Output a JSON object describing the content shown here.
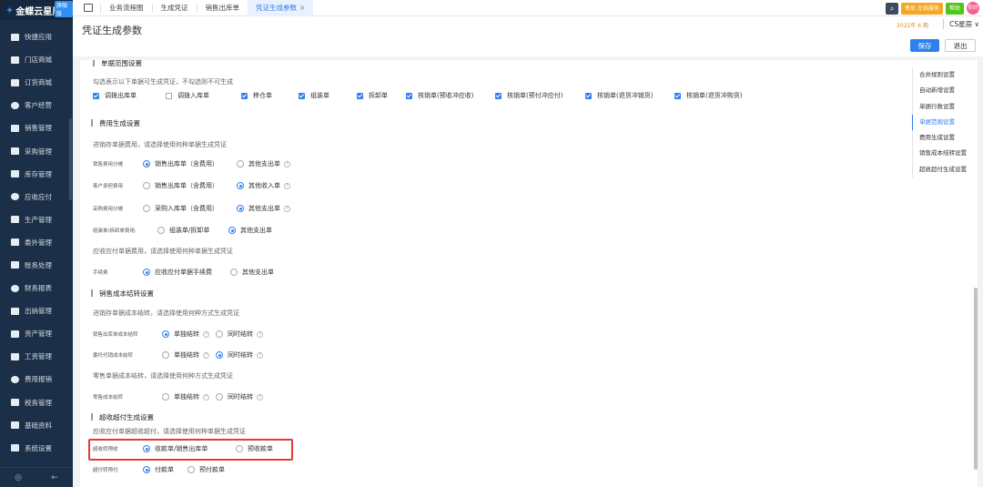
{
  "app": {
    "brand": "金蝶云星辰",
    "brand_tag": "旗舰版"
  },
  "sidebar": {
    "items": [
      {
        "label": "快捷应用"
      },
      {
        "label": "门店商城"
      },
      {
        "label": "订货商城"
      },
      {
        "label": "客户经营"
      },
      {
        "label": "销售管理"
      },
      {
        "label": "采购管理"
      },
      {
        "label": "库存管理"
      },
      {
        "label": "应收应付"
      },
      {
        "label": "生产管理"
      },
      {
        "label": "委外管理"
      },
      {
        "label": "账务处理"
      },
      {
        "label": "财务报表"
      },
      {
        "label": "出纳管理"
      },
      {
        "label": "资产管理"
      },
      {
        "label": "工资管理"
      },
      {
        "label": "费用报销"
      },
      {
        "label": "税务管理"
      },
      {
        "label": "基础资料"
      },
      {
        "label": "系统设置"
      }
    ],
    "footer_left": "◎",
    "footer_right": "←"
  },
  "topbar": {
    "tabs": [
      {
        "label": "业务流程图"
      },
      {
        "label": "生成凭证"
      },
      {
        "label": "销售出库单"
      },
      {
        "label": "凭证生成参数"
      }
    ],
    "active_tab_close": "×",
    "service_label": "售后 在线服务",
    "help_label": "帮助",
    "avatar_text": "你好"
  },
  "header": {
    "title": "凭证生成参数",
    "period": "2022年 6 期",
    "account": "CS星辰 ∨",
    "save_label": "保存",
    "exit_label": "退出"
  },
  "content": {
    "cut_heading": "单据范围设置",
    "scope_desc": "勾选表示以下单据可生成凭证，不勾选则不可生成",
    "scope_items": [
      {
        "label": "调拨出库单",
        "checked": true
      },
      {
        "label": "调拨入库单",
        "checked": false
      },
      {
        "label": "移仓单",
        "checked": true
      },
      {
        "label": "组装单",
        "checked": true
      },
      {
        "label": "拆卸单",
        "checked": true
      },
      {
        "label": "核销单(预收冲应收)",
        "checked": true
      },
      {
        "label": "核销单(预付冲应付)",
        "checked": true
      },
      {
        "label": "核销单(退货冲销货)",
        "checked": true
      },
      {
        "label": "核销单(退货冲购货)",
        "checked": true
      }
    ],
    "fee_section": "费用生成设置",
    "fee_desc": "进销存单据费用，请选择使用何种单据生成凭证",
    "fee_rows": [
      {
        "label": "销售费用分摊",
        "opt1": "销售出库单（含费用）",
        "opt2": "其他支出单",
        "selected": 1
      },
      {
        "label": "客户承担费用",
        "opt1": "销售出库单（含费用）",
        "opt2": "其他收入单",
        "selected": 2
      },
      {
        "label": "采购费用分摊",
        "opt1": "采购入库单（含费用）",
        "opt2": "其他支出单",
        "selected": 2
      },
      {
        "label": "组装单/拆卸单费用:",
        "opt1": "组装单/拆卸单",
        "opt2": "其他支出单",
        "selected": 2
      }
    ],
    "arap_desc": "应收应付单据费用，请选择使用何种单据生成凭证",
    "handling": {
      "label": "手续费",
      "opt1": "应收应付单据手续费",
      "opt2": "其他支出单",
      "selected": 1
    },
    "cost_section": "销售成本结转设置",
    "cost_desc": "进销存单据成本结转，请选择使用何种方式生成凭证",
    "cost_rows": [
      {
        "label": "销售出库单成本结转",
        "opt1": "单独结转",
        "opt2": "同时结转",
        "selected": 1
      },
      {
        "label": "委托代销成本结转",
        "opt1": "单独结转",
        "opt2": "同时结转",
        "selected": 2
      }
    ],
    "retail_desc": "零售单据成本结转，请选择使用何种方式生成凭证",
    "retail_row": {
      "label": "零售成本结转",
      "opt1": "单独结转",
      "opt2": "同时结转",
      "selected": 0
    },
    "over_section": "超收超付生成设置",
    "over_desc": "应收应付单据超收超付，请选择使用何种单据生成凭证",
    "over_rows": [
      {
        "label": "超收转预收",
        "opt1": "收款单/销售出库单",
        "opt2": "预收款单",
        "selected": 1
      },
      {
        "label": "超付转预付",
        "opt1": "付款单",
        "opt2": "预付款单",
        "selected": 1
      }
    ],
    "help_glyph": "?"
  },
  "rightnav": {
    "items": [
      {
        "label": "合并规则设置",
        "active": false
      },
      {
        "label": "自动新增设置",
        "active": false
      },
      {
        "label": "单据行数设置",
        "active": false
      },
      {
        "label": "单据范围设置",
        "active": true
      },
      {
        "label": "费用生成设置",
        "active": false
      },
      {
        "label": "销售成本结转设置",
        "active": false
      },
      {
        "label": "超收超付生成设置",
        "active": false
      }
    ]
  },
  "colors": {
    "accent": "#2e7ff0",
    "sidebar_bg": "#1b2f48",
    "highlight": "#e53935"
  }
}
